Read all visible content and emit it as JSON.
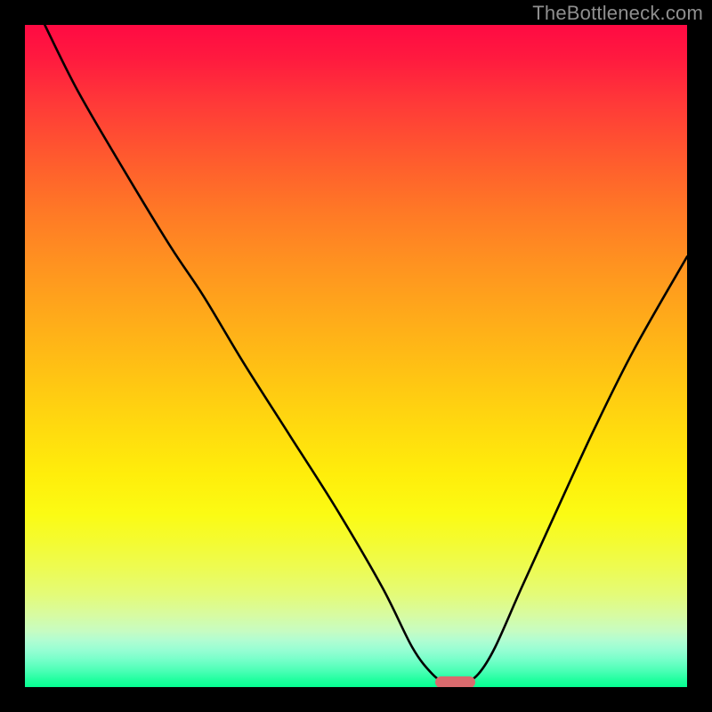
{
  "watermark": "TheBottleneck.com",
  "chart_data": {
    "type": "line",
    "title": "",
    "xlabel": "",
    "ylabel": "",
    "xlim": [
      0,
      100
    ],
    "ylim": [
      0,
      100
    ],
    "series": [
      {
        "name": "bottleneck-curve",
        "x": [
          3,
          8,
          15,
          22,
          27,
          33,
          40,
          47,
          54,
          58.5,
          61.5,
          63.5,
          66.5,
          68.5,
          71,
          75,
          80,
          86,
          92,
          100
        ],
        "y": [
          100,
          90,
          78,
          66.5,
          59,
          49,
          38,
          27,
          15,
          6,
          2,
          0.8,
          0.8,
          2,
          6,
          15,
          26,
          39,
          51,
          65
        ]
      }
    ],
    "marker": {
      "name": "optimal-indicator",
      "x_start": 62,
      "x_end": 68,
      "y": 0.8,
      "color": "#d96a6d"
    },
    "background": {
      "type": "vertical-gradient",
      "stops": [
        {
          "pos": 0,
          "color": "#ff0a43"
        },
        {
          "pos": 50,
          "color": "#ffc114"
        },
        {
          "pos": 74,
          "color": "#fbfb14"
        },
        {
          "pos": 100,
          "color": "#05ff92"
        }
      ]
    }
  }
}
